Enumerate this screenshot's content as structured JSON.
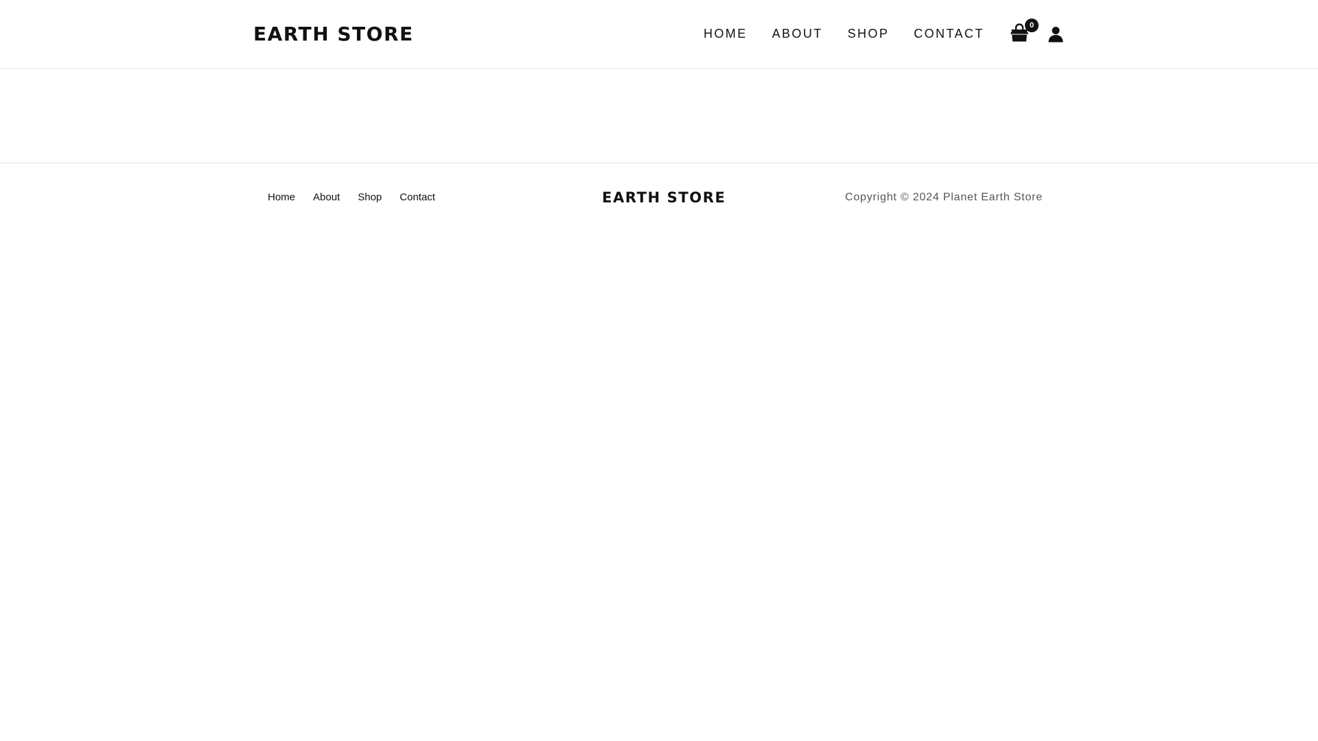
{
  "header": {
    "logo": "EARTH STORE",
    "nav": [
      {
        "label": "HOME"
      },
      {
        "label": "ABOUT"
      },
      {
        "label": "SHOP"
      },
      {
        "label": "CONTACT"
      }
    ],
    "cart": {
      "icon": "shopping-bag-icon",
      "count": "0"
    },
    "account": {
      "icon": "user-icon"
    }
  },
  "footer": {
    "nav": [
      {
        "label": "Home"
      },
      {
        "label": "About"
      },
      {
        "label": "Shop"
      },
      {
        "label": "Contact"
      }
    ],
    "logo": "EARTH STORE",
    "copyright": "Copyright © 2024 Planet Earth Store"
  },
  "colors": {
    "text": "#111111",
    "muted": "#555555",
    "border": "#e6e6e6",
    "background": "#ffffff"
  }
}
